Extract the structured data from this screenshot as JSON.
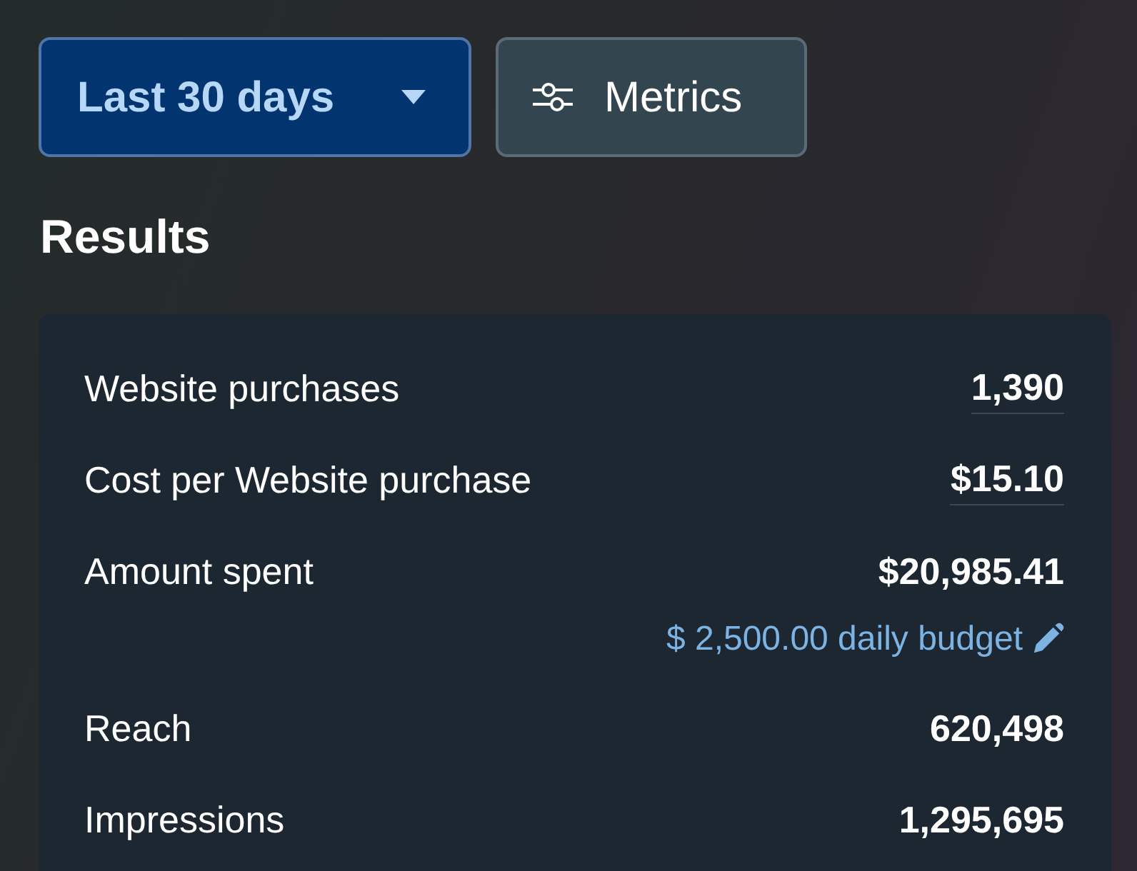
{
  "filters": {
    "date_range": {
      "label": "Last 30 days"
    },
    "metrics_button": {
      "label": "Metrics"
    }
  },
  "section_title": "Results",
  "results": [
    {
      "label": "Website purchases",
      "value": "1,390",
      "underlined": true
    },
    {
      "label": "Cost per Website purchase",
      "value": "$15.10",
      "underlined": true
    },
    {
      "label": "Amount spent",
      "value": "$20,985.41",
      "underlined": false,
      "budget": "$ 2,500.00 daily budget"
    },
    {
      "label": "Reach",
      "value": "620,498",
      "underlined": false
    },
    {
      "label": "Impressions",
      "value": "1,295,695",
      "underlined": false
    }
  ]
}
